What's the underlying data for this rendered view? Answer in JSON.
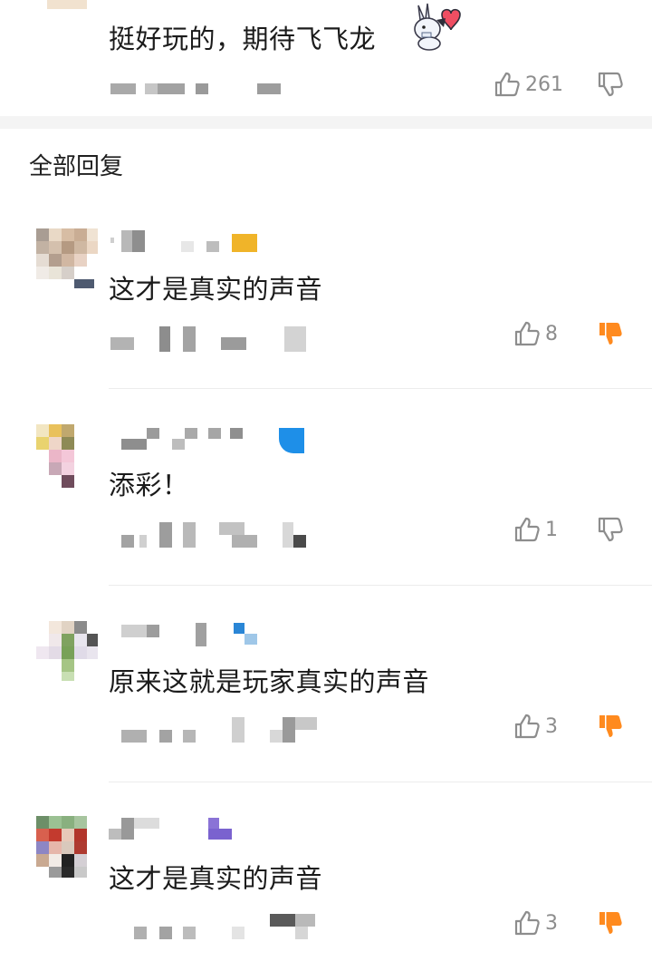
{
  "top_comment": {
    "text": "挺好玩的，期待飞飞龙",
    "emoji": "bunny-heart-sticker",
    "like_count": "261",
    "disliked": false
  },
  "section_title": "全部回复",
  "replies": [
    {
      "text": "这才是真实的声音",
      "like_count": "8",
      "disliked": true
    },
    {
      "text": "添彩！",
      "like_count": "1",
      "disliked": false
    },
    {
      "text": "原来这就是玩家真实的声音",
      "like_count": "3",
      "disliked": true
    },
    {
      "text": "这才是真实的声音",
      "like_count": "3",
      "disliked": true
    }
  ],
  "colors": {
    "dislike_active": "#ff8a1e",
    "icon_inactive": "#8d8d8d",
    "divider": "#ececec",
    "section_bg": "#f4f4f4"
  }
}
